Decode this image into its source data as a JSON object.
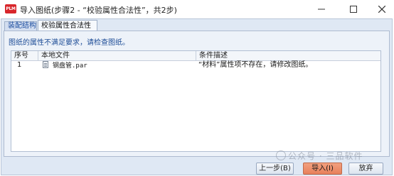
{
  "window": {
    "app_icon_text": "PLM",
    "title": "导入图纸(步骤2 - “校验属性合法性”，共2步)"
  },
  "tabs": [
    {
      "label": "装配结构",
      "active": false
    },
    {
      "label": "校验属性合法性",
      "active": true
    }
  ],
  "notice": "图纸的属性不满足要求，请检查图纸。",
  "table": {
    "columns": [
      "序号",
      "本地文件",
      "条件描述"
    ],
    "rows": [
      {
        "index": "1",
        "file": "钢盘管.par",
        "file_icon": "document-icon",
        "description": "“材料”属性项不存在，请修改图纸。"
      }
    ]
  },
  "buttons": {
    "back": "上一步(B)",
    "import": "导入(I)",
    "cancel": "放弃"
  },
  "watermark": "公众号 · 三品软件",
  "colors": {
    "accent": "#1d4c96",
    "primary_button": "#e8805b",
    "brand": "#d8262b"
  }
}
